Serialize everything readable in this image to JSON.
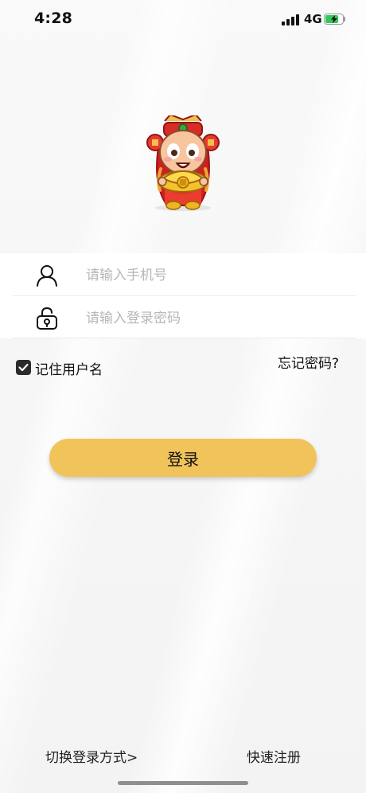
{
  "status_bar": {
    "time": "4:28",
    "network": "4G",
    "battery": 0.7
  },
  "logo": {
    "name": "fortune-god-mascot"
  },
  "form": {
    "phone_placeholder": "请输入手机号",
    "password_placeholder": "请输入登录密码"
  },
  "remember": {
    "label": "记住用户名",
    "checked": true
  },
  "forgot_label": "忘记密码?",
  "login_button": {
    "label": "登录"
  },
  "footer": {
    "switch_login": "切换登录方式>",
    "register": "快速注册"
  },
  "colors": {
    "accent": "#f1c35b",
    "background": "#f6f6f6",
    "card": "#ffffff",
    "battery": "#34c759",
    "placeholder": "#b7b7b7"
  }
}
